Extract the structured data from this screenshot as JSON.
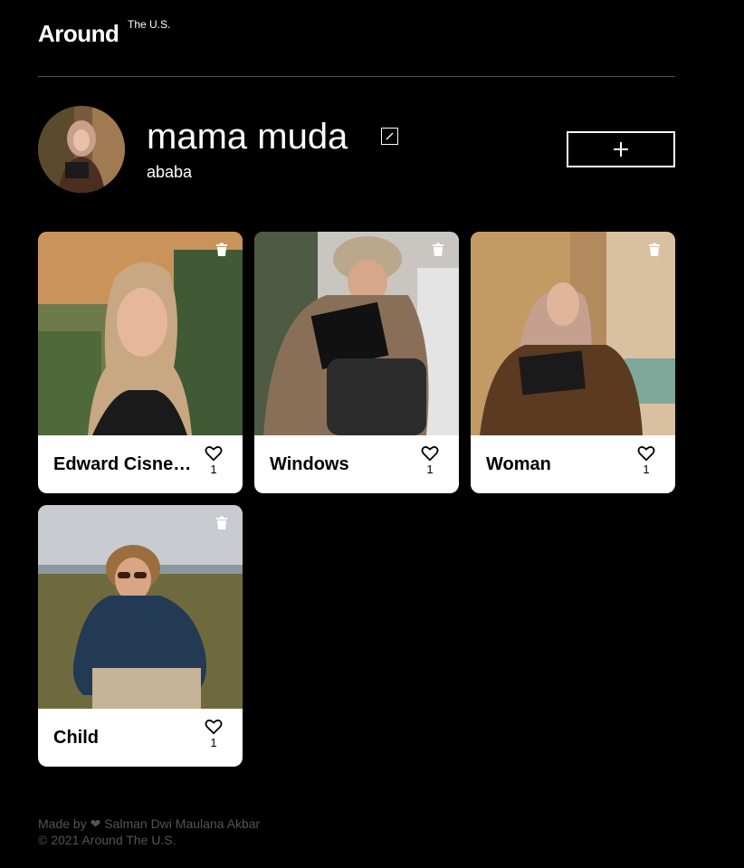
{
  "header": {
    "logo": "Around",
    "logo_sub": "The U.S."
  },
  "profile": {
    "name": "mama muda",
    "about": "ababa"
  },
  "icons": {
    "edit": "pencil-icon",
    "add": "plus-icon",
    "delete": "trash-icon",
    "like": "heart-icon"
  },
  "cards": [
    {
      "title": "Edward Cisneros",
      "likes": "1",
      "image": "portrait-blonde-woman"
    },
    {
      "title": "Windows",
      "likes": "1",
      "image": "woman-with-laptop-and-backpack"
    },
    {
      "title": "Woman",
      "likes": "1",
      "image": "woman-in-hijab-holding-laptop"
    },
    {
      "title": "Child",
      "likes": "1",
      "image": "child-with-sunglasses"
    }
  ],
  "footer": {
    "made_by": "Made by ❤ Salman Dwi Maulana Akbar",
    "copyright": "© 2021 Around The U.S."
  }
}
